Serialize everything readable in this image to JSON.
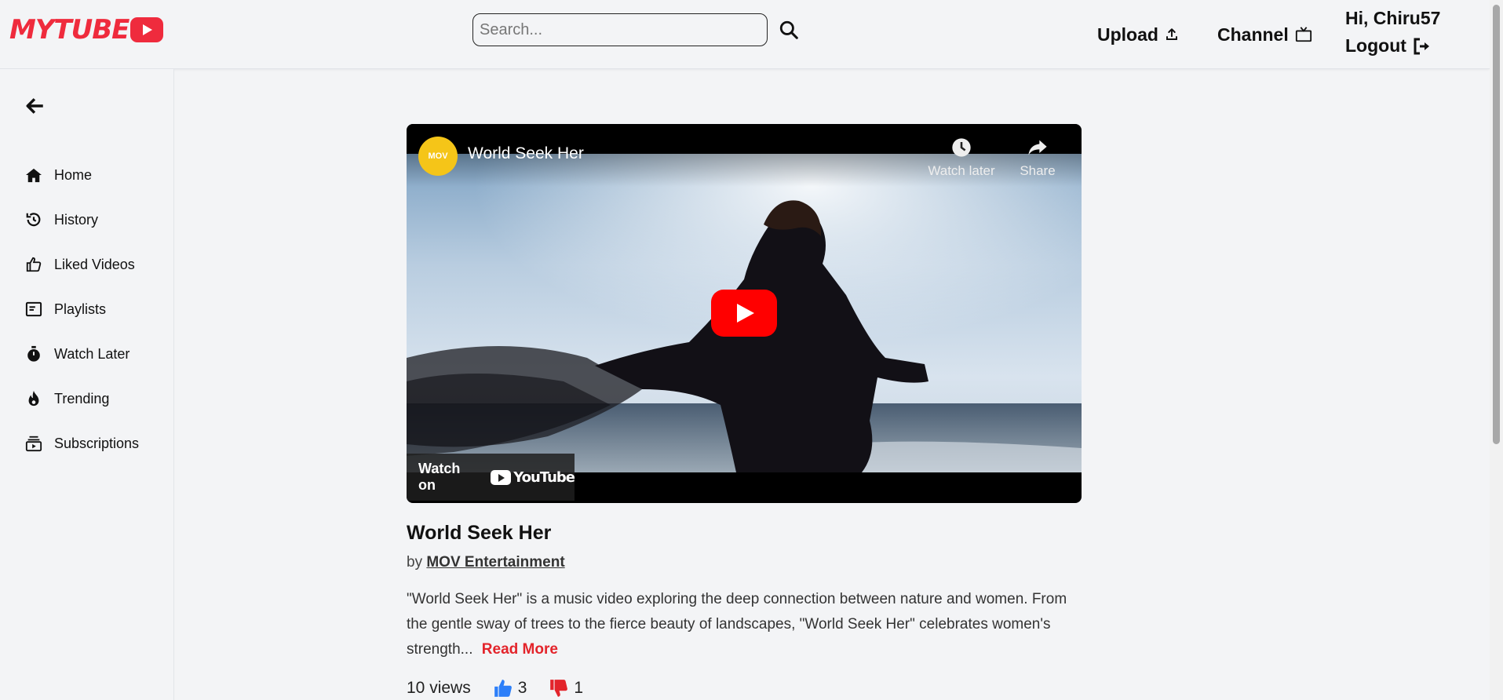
{
  "brand": {
    "logo_text": "MYTUBE",
    "accent": "#ef2b3d"
  },
  "header": {
    "search_placeholder": "Search...",
    "upload_label": "Upload",
    "channel_label": "Channel",
    "greeting": "Hi, Chiru57",
    "logout_label": "Logout"
  },
  "sidebar": {
    "items": [
      {
        "label": "Home",
        "icon": "home-icon"
      },
      {
        "label": "History",
        "icon": "history-icon"
      },
      {
        "label": "Liked Videos",
        "icon": "thumbs-up-icon"
      },
      {
        "label": "Playlists",
        "icon": "playlist-icon"
      },
      {
        "label": "Watch Later",
        "icon": "stopwatch-icon"
      },
      {
        "label": "Trending",
        "icon": "fire-icon"
      },
      {
        "label": "Subscriptions",
        "icon": "subscriptions-icon"
      }
    ]
  },
  "player": {
    "channel_avatar_text": "MOV",
    "title": "World Seek Her",
    "watch_later_label": "Watch later",
    "share_label": "Share",
    "watch_on_label": "Watch on",
    "youtube_label": "YouTube"
  },
  "video": {
    "title": "World Seek Her",
    "by_label": "by",
    "channel": "MOV Entertainment",
    "description": "\"World Seek Her\" is a music video exploring the deep connection between nature and women. From the gentle sway of trees to the fierce beauty of landscapes, \"World Seek Her\" celebrates women's strength...",
    "read_more": "Read More",
    "views": "10 views",
    "likes": "3",
    "dislikes": "1"
  }
}
